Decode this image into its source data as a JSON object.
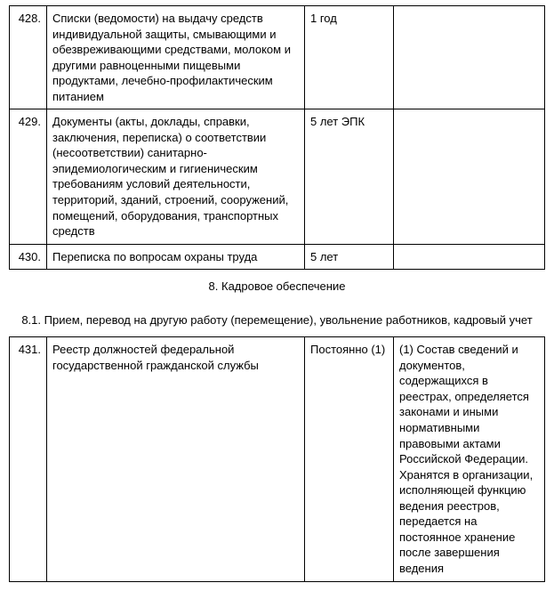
{
  "rows": {
    "r428": {
      "num": "428.",
      "desc": "Списки (ведомости) на выдачу средств индивидуальной защиты, смывающими и обезвреживающими средствами, молоком и другими равноценными пищевыми продуктами, лечебно-профилактическим питанием",
      "term": "1 год",
      "note": ""
    },
    "r429": {
      "num": "429.",
      "desc": "Документы (акты, доклады, справки, заключения, переписка) о соответствии (несоответствии) санитарно-эпидемиологическим и гигиеническим требованиям условий деятельности, территорий, зданий, строений, сооружений, помещений, оборудования, транспортных средств",
      "term": "5 лет ЭПК",
      "note": ""
    },
    "r430": {
      "num": "430.",
      "desc": "Переписка по вопросам охраны труда",
      "term": "5 лет",
      "note": ""
    },
    "r431": {
      "num": "431.",
      "desc": "Реестр должностей федеральной государственной гражданской службы",
      "term": "Постоянно (1)",
      "note": "(1) Состав сведений и документов, содержащихся в реестрах, определяется законами и иными нормативными правовыми актами Российской Федерации. Хранятся в организации, исполняющей функцию ведения реестров, передается на постоянное хранение после завершения ведения"
    }
  },
  "section": {
    "header": "8. Кадровое обеспечение",
    "subheader": "8.1. Прием, перевод на другую работу (перемещение), увольнение работников, кадровый учет"
  }
}
